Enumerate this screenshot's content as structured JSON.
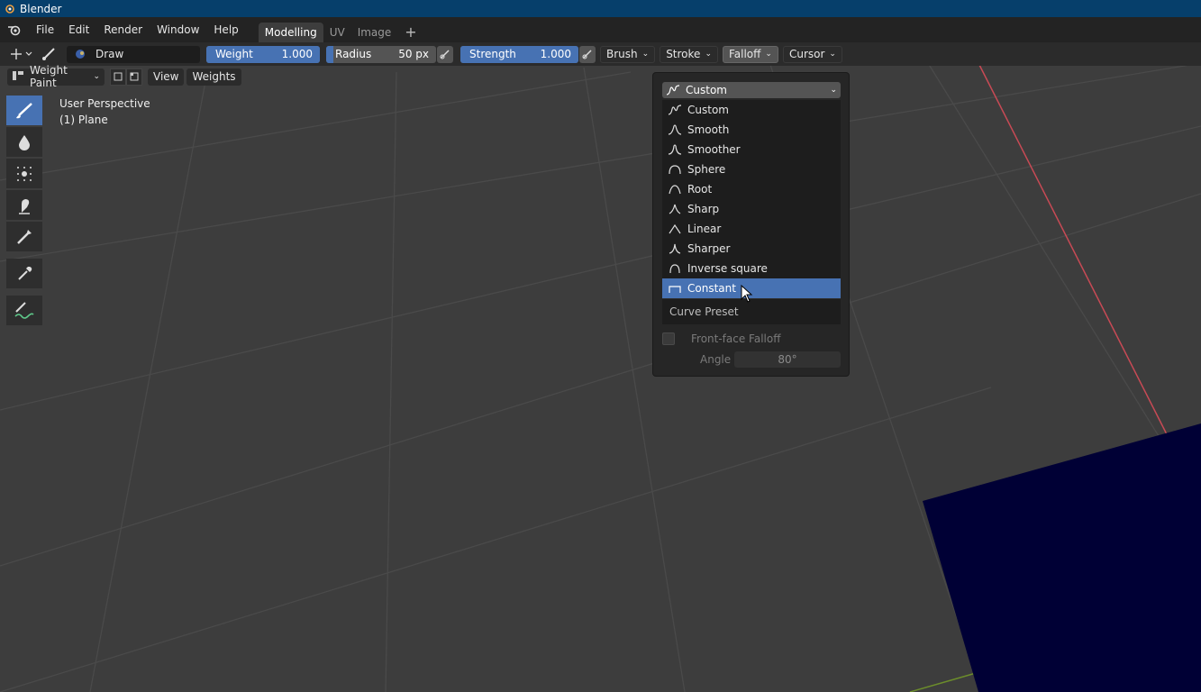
{
  "window": {
    "title": "Blender"
  },
  "menubar": {
    "items": [
      "File",
      "Edit",
      "Render",
      "Window",
      "Help"
    ],
    "workspaces": [
      "Modelling",
      "UV",
      "Image"
    ],
    "add_workspace": "+"
  },
  "tool_header": {
    "brush_name": "Draw",
    "weight": {
      "label": "Weight",
      "value": "1.000",
      "fraction": 1.0
    },
    "radius": {
      "label": "Radius",
      "value": "50 px"
    },
    "strength": {
      "label": "Strength",
      "value": "1.000",
      "fraction": 1.0
    },
    "dropdowns": [
      "Brush",
      "Stroke",
      "Falloff",
      "Cursor"
    ],
    "open_dropdown": "Falloff"
  },
  "viewport_header": {
    "mode": "Weight Paint",
    "menus": [
      "View",
      "Weights"
    ]
  },
  "viewport_info": {
    "perspective": "User Perspective",
    "object": "(1) Plane"
  },
  "falloff_popup": {
    "selected_preset": "Custom",
    "options": [
      {
        "label": "Custom",
        "icon": "curve-custom-icon"
      },
      {
        "label": "Smooth",
        "icon": "curve-smooth-icon"
      },
      {
        "label": "Smoother",
        "icon": "curve-smoother-icon"
      },
      {
        "label": "Sphere",
        "icon": "curve-sphere-icon"
      },
      {
        "label": "Root",
        "icon": "curve-root-icon"
      },
      {
        "label": "Sharp",
        "icon": "curve-sharp-icon"
      },
      {
        "label": "Linear",
        "icon": "curve-linear-icon"
      },
      {
        "label": "Sharper",
        "icon": "curve-sharper-icon"
      },
      {
        "label": "Inverse square",
        "icon": "curve-inverse-square-icon"
      },
      {
        "label": "Constant",
        "icon": "curve-constant-icon"
      }
    ],
    "highlighted": "Constant",
    "footer": "Curve Preset",
    "front_face_falloff": {
      "label": "Front-face Falloff",
      "checked": false
    },
    "angle": {
      "label": "Angle",
      "value": "80°"
    }
  },
  "colors": {
    "accent": "#4772b3",
    "titlebar": "#063f6b",
    "viewport_bg": "#3d3d3d",
    "plane": "#000035"
  }
}
